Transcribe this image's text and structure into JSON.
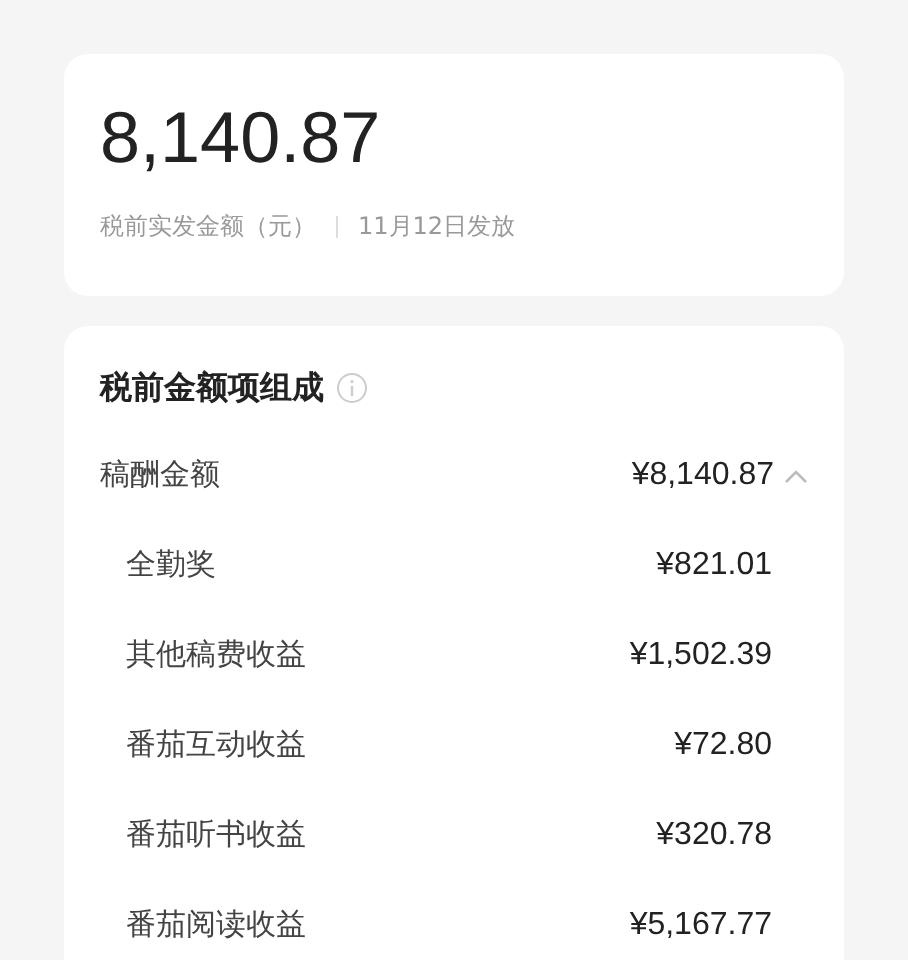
{
  "summary": {
    "amount": "8,140.87",
    "label": "税前实发金额（元）",
    "date": "11月12日发放"
  },
  "breakdown": {
    "title": "税前金额项组成",
    "items": [
      {
        "label": "稿酬金额",
        "amount": "¥8,140.87",
        "expanded": true,
        "children": [
          {
            "label": "全勤奖",
            "amount": "¥821.01"
          },
          {
            "label": "其他稿费收益",
            "amount": "¥1,502.39"
          },
          {
            "label": "番茄互动收益",
            "amount": "¥72.80"
          },
          {
            "label": "番茄听书收益",
            "amount": "¥320.78"
          },
          {
            "label": "番茄阅读收益",
            "amount": "¥5,167.77"
          }
        ]
      }
    ]
  }
}
